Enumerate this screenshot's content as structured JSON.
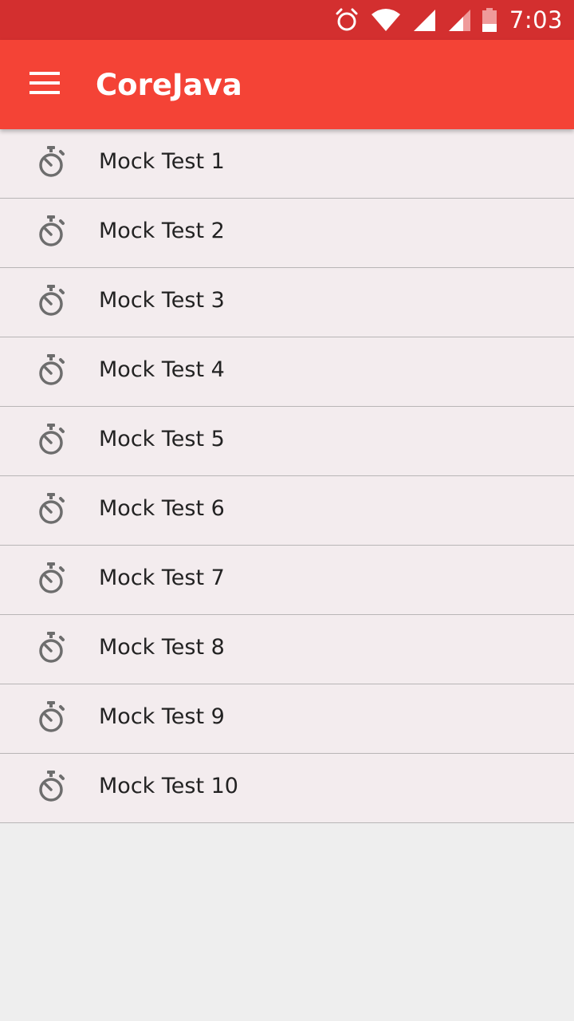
{
  "status_bar": {
    "time": "7:03",
    "icons": [
      "alarm-icon",
      "wifi-icon",
      "signal-icon",
      "signal-icon",
      "battery-icon"
    ]
  },
  "app_bar": {
    "title": "CoreJava",
    "menu_icon": "hamburger-menu-icon",
    "color": "#f44336"
  },
  "list": {
    "item_icon": "stopwatch-icon",
    "items": [
      {
        "label": "Mock Test 1"
      },
      {
        "label": "Mock Test 2"
      },
      {
        "label": "Mock Test 3"
      },
      {
        "label": "Mock Test 4"
      },
      {
        "label": "Mock Test 5"
      },
      {
        "label": "Mock Test 6"
      },
      {
        "label": "Mock Test 7"
      },
      {
        "label": "Mock Test 8"
      },
      {
        "label": "Mock Test 9"
      },
      {
        "label": "Mock Test 10"
      }
    ]
  }
}
